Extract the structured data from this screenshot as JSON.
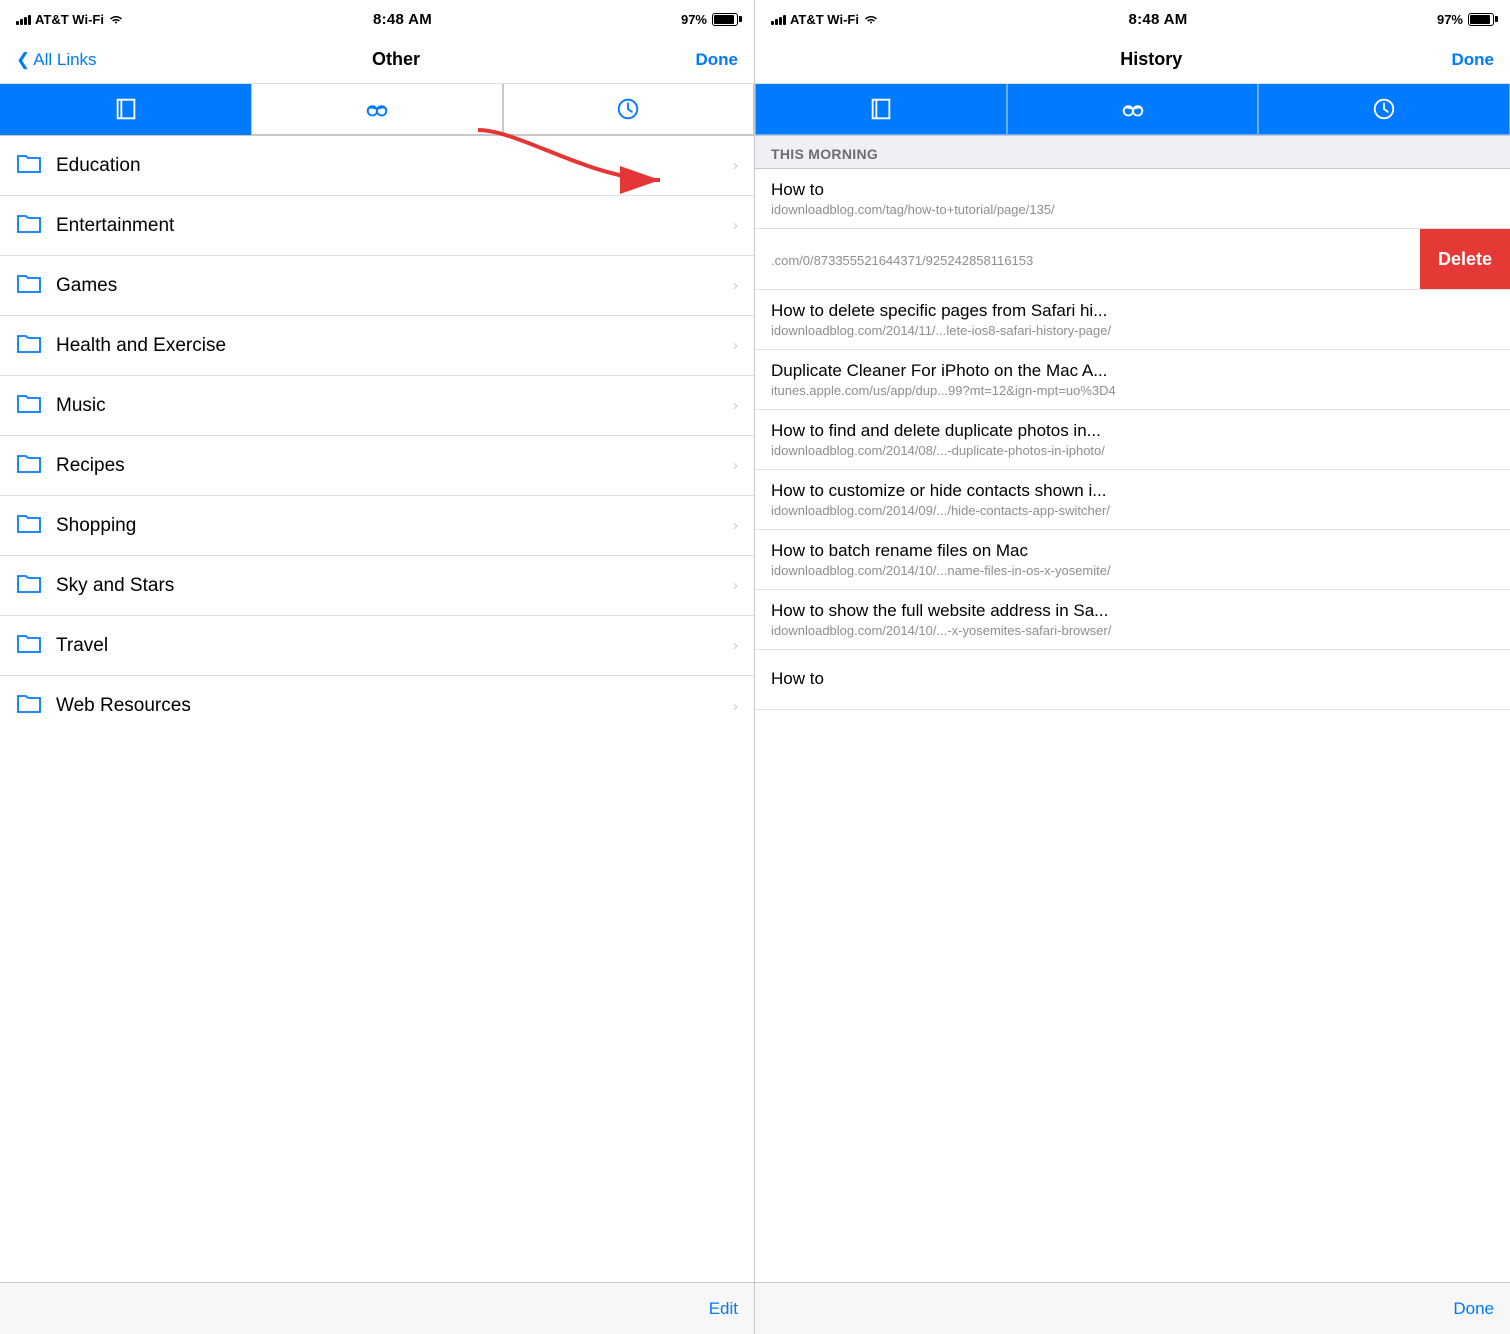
{
  "left": {
    "statusBar": {
      "carrier": "AT&T Wi-Fi",
      "time": "8:48 AM",
      "battery": "97%"
    },
    "nav": {
      "backLabel": "All Links",
      "title": "Other",
      "actionLabel": "Done"
    },
    "tabs": [
      {
        "id": "bookmarks",
        "active": true
      },
      {
        "id": "reading",
        "active": false
      },
      {
        "id": "history",
        "active": false
      }
    ],
    "folders": [
      {
        "label": "Education"
      },
      {
        "label": "Entertainment"
      },
      {
        "label": "Games"
      },
      {
        "label": "Health and Exercise"
      },
      {
        "label": "Music"
      },
      {
        "label": "Recipes"
      },
      {
        "label": "Shopping"
      },
      {
        "label": "Sky and Stars"
      },
      {
        "label": "Travel"
      },
      {
        "label": "Web Resources"
      }
    ],
    "bottomAction": "Edit"
  },
  "right": {
    "statusBar": {
      "carrier": "AT&T Wi-Fi",
      "time": "8:48 AM",
      "battery": "97%"
    },
    "nav": {
      "title": "History",
      "actionLabel": "Done"
    },
    "tabs": [
      {
        "id": "bookmarks",
        "active": false
      },
      {
        "id": "reading",
        "active": false
      },
      {
        "id": "history",
        "active": false
      }
    ],
    "sectionHeader": "This Morning",
    "items": [
      {
        "title": "How to",
        "url": "idownloadblog.com/tag/how-to+tutorial/page/135/",
        "swiped": false
      },
      {
        "title": "",
        "url": ".com/0/873355521644371/925242858116153",
        "swiped": true
      },
      {
        "title": "How to delete specific pages from Safari hi...",
        "url": "idownloadblog.com/2014/11/...lete-ios8-safari-history-page/",
        "swiped": false
      },
      {
        "title": "Duplicate Cleaner For iPhoto on the Mac A...",
        "url": "itunes.apple.com/us/app/dup...99?mt=12&ign-mpt=uo%3D4",
        "swiped": false
      },
      {
        "title": "How to find and delete duplicate photos in...",
        "url": "idownloadblog.com/2014/08/...-duplicate-photos-in-iphoto/",
        "swiped": false
      },
      {
        "title": "How to customize or hide contacts shown i...",
        "url": "idownloadblog.com/2014/09/.../hide-contacts-app-switcher/",
        "swiped": false
      },
      {
        "title": "How to batch rename files on Mac",
        "url": "idownloadblog.com/2014/10/...name-files-in-os-x-yosemite/",
        "swiped": false
      },
      {
        "title": "How to show the full website address in Sa...",
        "url": "idownloadblog.com/2014/10/...-x-yosemites-safari-browser/",
        "swiped": false
      },
      {
        "title": "How to",
        "url": "",
        "swiped": false
      }
    ],
    "deleteLabel": "Delete",
    "bottomAction": "Done"
  }
}
